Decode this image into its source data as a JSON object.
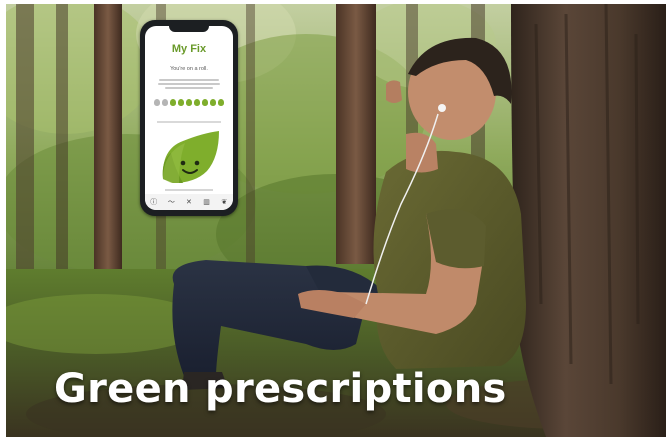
{
  "headline": "Green prescriptions",
  "phone_app": {
    "title": "My Fix",
    "subtitle": "You're on a roll.",
    "progress_dots": {
      "filled": 7,
      "total": 9
    },
    "nav_icons": [
      "info-icon",
      "activity-icon",
      "close-icon",
      "stats-icon",
      "leaf-icon"
    ]
  },
  "colors": {
    "brand_green": "#6a9a2b",
    "leaf_green": "#7fae2c",
    "headline_text": "#ffffff"
  }
}
